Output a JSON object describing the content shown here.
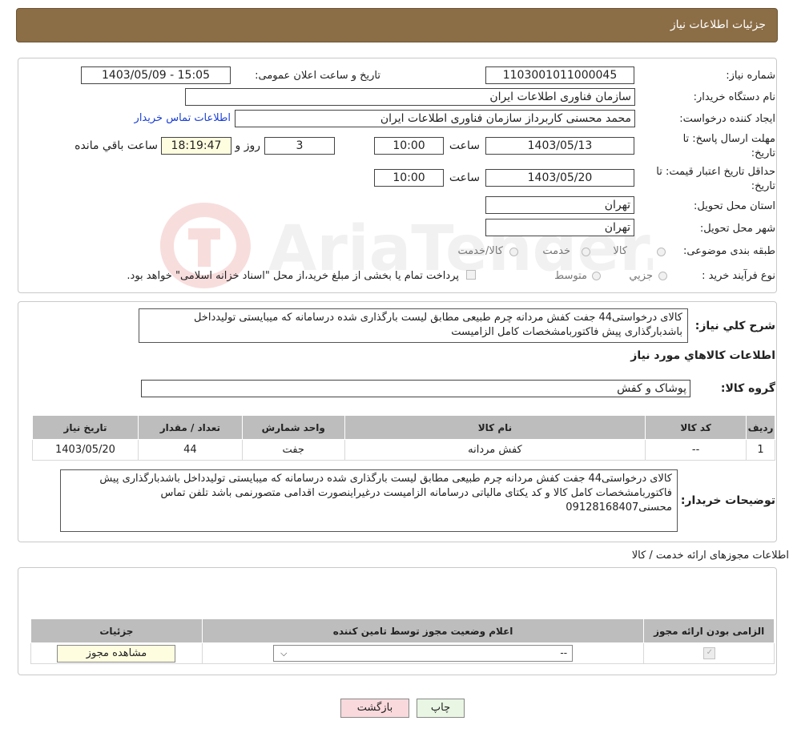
{
  "header": {
    "title": "جزئیات اطلاعات نیاز"
  },
  "form": {
    "need_number_label": "شماره نیاز:",
    "need_number": "1103001011000045",
    "announce_label": "تاریخ و ساعت اعلان عمومی:",
    "announce_value": "1403/05/09 - 15:05",
    "buyer_org_label": "نام دستگاه خریدار:",
    "buyer_org": "سازمان فناوری اطلاعات ایران",
    "creator_label": "ایجاد کننده درخواست:",
    "creator": "محمد محسنی کاربرداز سازمان فناوری اطلاعات ایران",
    "contact_link": "اطلاعات تماس خریدار",
    "deadline_label_1": "مهلت ارسال پاسخ: تا",
    "deadline_label_2": "تاریخ:",
    "deadline_date": "1403/05/13",
    "time_label": "ساعت",
    "deadline_time": "10:00",
    "days_value": "3",
    "days_label": "روز و",
    "remaining_time": "18:19:47",
    "remaining_label": "ساعت باقي مانده",
    "validity_label_1": "حداقل تاریخ اعتبار قیمت: تا",
    "validity_label_2": "تاریخ:",
    "validity_date": "1403/05/20",
    "validity_time": "10:00",
    "province_label": "استان محل تحویل:",
    "province": "تهران",
    "city_label": "شهر محل تحویل:",
    "city": "تهران",
    "category_label": "طبقه بندی موضوعی:",
    "category_options": [
      "کالا",
      "خدمت",
      "کالا/خدمت"
    ],
    "process_label": "نوع فرآیند خرید :",
    "process_options": [
      "جزیي",
      "متوسط"
    ],
    "process_note": "پرداخت تمام يا بخشی از مبلغ خريد،از محل \"اسناد خزانه اسلامی\" خواهد بود."
  },
  "watermark": {
    "text": "AriaTender.neT"
  },
  "description": {
    "label": "شرح کلي نياز:",
    "text": "کالای درخواستی44 جفت کفش مردانه چرم طبیعی مطابق لیست بارگذاری شده درسامانه که میبایستی تولیدداخل باشدبارگذاری پیش فاکتوربامشخصات کامل  الزامیست"
  },
  "goods": {
    "title": "اطلاعات کالاهاي مورد نياز",
    "group_label": "گروه کالا:",
    "group_value": "پوشاک و کفش",
    "columns": [
      "ردیف",
      "کد کالا",
      "نام کالا",
      "واحد شمارش",
      "تعداد / مقدار",
      "تاریخ نیاز"
    ],
    "rows": [
      {
        "row": "1",
        "code": "--",
        "name": "کفش مردانه",
        "unit": "جفت",
        "qty": "44",
        "date": "1403/05/20"
      }
    ]
  },
  "buyer_notes": {
    "label": "توضیحات خریدار:",
    "text": "کالای درخواستی44 جفت کفش مردانه چرم طبیعی مطابق لیست بارگذاری شده درسامانه که میبایستی تولیدداخل باشدبارگذاری پیش فاکتوربامشخصات کامل کالا و کد یکتای مالیاتی درسامانه الزامیست درغیراینصورت اقدامی متصورنمی باشد تلفن تماس محسنی09128168407"
  },
  "permits": {
    "title": "اطلاعات مجوزهای ارائه خدمت / کالا",
    "columns": [
      "الزامی بودن ارائه مجوز",
      "اعلام وضعیت مجوز توسط تامین کننده",
      "جزئیات"
    ],
    "select_value": "--",
    "view_button": "مشاهده مجوز"
  },
  "actions": {
    "print": "چاپ",
    "back": "بازگشت"
  },
  "colors": {
    "header_bg": "#8b6d46",
    "link": "#1a3fd6",
    "table_header": "#bdbdbd",
    "back_button": "#f9d9dc",
    "print_button": "#e8f6e3",
    "highlight": "#fffde0"
  }
}
